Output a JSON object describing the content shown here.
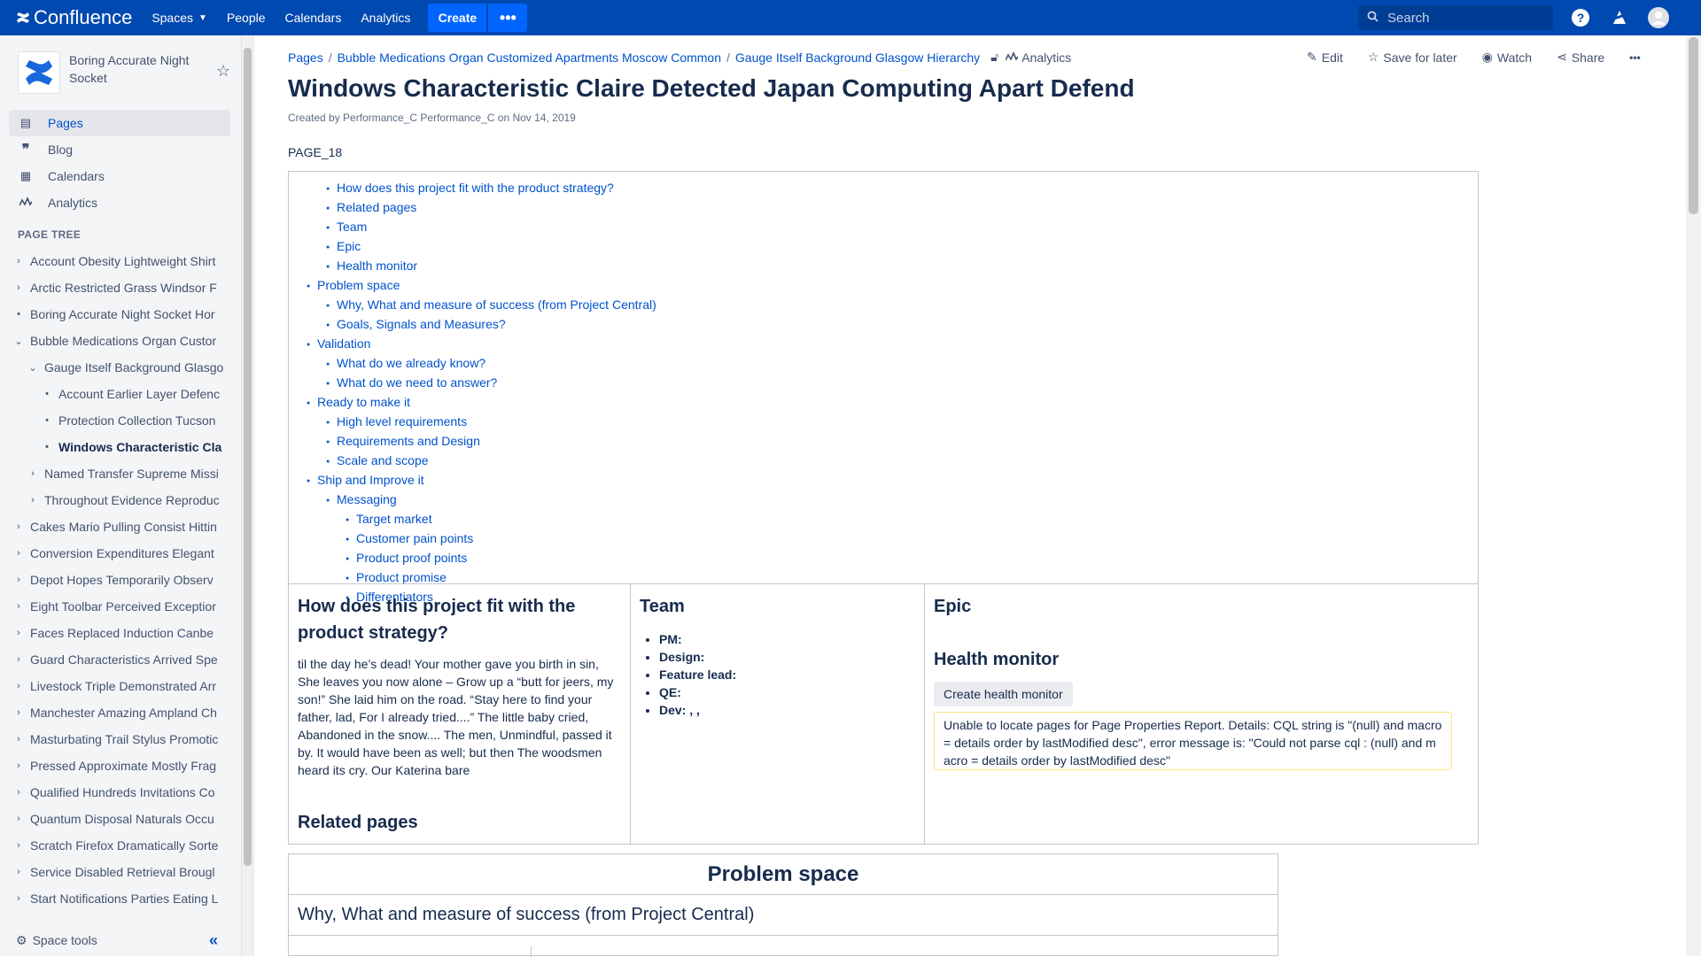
{
  "topnav": {
    "logo": "Confluence",
    "spaces": "Spaces",
    "people": "People",
    "calendars": "Calendars",
    "analytics": "Analytics",
    "create": "Create",
    "more": "•••",
    "search_placeholder": "Search"
  },
  "sidebar": {
    "space_name": "Boring Accurate Night Socket",
    "nav": [
      {
        "label": "Pages",
        "icon": "pages-icon"
      },
      {
        "label": "Blog",
        "icon": "quote-icon"
      },
      {
        "label": "Calendars",
        "icon": "calendar-icon"
      },
      {
        "label": "Analytics",
        "icon": "analytics-icon"
      }
    ],
    "tree_title": "PAGE TREE",
    "tree": [
      {
        "label": "Account Obesity Lightweight Shirt",
        "depth": 0,
        "toggle": "›"
      },
      {
        "label": "Arctic Restricted Grass Windsor F",
        "depth": 0,
        "toggle": "›"
      },
      {
        "label": "Boring Accurate Night Socket Hor",
        "depth": 0,
        "toggle": "•"
      },
      {
        "label": "Bubble Medications Organ Custor",
        "depth": 0,
        "toggle": "⌄"
      },
      {
        "label": "Gauge Itself Background Glasgo",
        "depth": 1,
        "toggle": "⌄"
      },
      {
        "label": "Account Earlier Layer Defenc",
        "depth": 2,
        "toggle": "•"
      },
      {
        "label": "Protection Collection Tucson",
        "depth": 2,
        "toggle": "•"
      },
      {
        "label": "Windows Characteristic Cla",
        "depth": 2,
        "toggle": "•",
        "current": true
      },
      {
        "label": "Named Transfer Supreme Missi",
        "depth": 1,
        "toggle": "›"
      },
      {
        "label": "Throughout Evidence Reproduc",
        "depth": 1,
        "toggle": "›"
      },
      {
        "label": "Cakes Mario Pulling Consist Hittin",
        "depth": 0,
        "toggle": "›"
      },
      {
        "label": "Conversion Expenditures Elegant",
        "depth": 0,
        "toggle": "›"
      },
      {
        "label": "Depot Hopes Temporarily Observ",
        "depth": 0,
        "toggle": "›"
      },
      {
        "label": "Eight Toolbar Perceived Exceptior",
        "depth": 0,
        "toggle": "›"
      },
      {
        "label": "Faces Replaced Induction Canbe",
        "depth": 0,
        "toggle": "›"
      },
      {
        "label": "Guard Characteristics Arrived Spe",
        "depth": 0,
        "toggle": "›"
      },
      {
        "label": "Livestock Triple Demonstrated Arr",
        "depth": 0,
        "toggle": "›"
      },
      {
        "label": "Manchester Amazing Ampland Ch",
        "depth": 0,
        "toggle": "›"
      },
      {
        "label": "Masturbating Trail Stylus Promotic",
        "depth": 0,
        "toggle": "›"
      },
      {
        "label": "Pressed Approximate Mostly Frag",
        "depth": 0,
        "toggle": "›"
      },
      {
        "label": "Qualified Hundreds Invitations Co",
        "depth": 0,
        "toggle": "›"
      },
      {
        "label": "Quantum Disposal Naturals Occu",
        "depth": 0,
        "toggle": "›"
      },
      {
        "label": "Scratch Firefox Dramatically Sorte",
        "depth": 0,
        "toggle": "›"
      },
      {
        "label": "Service Disabled Retrieval Brougl",
        "depth": 0,
        "toggle": "›"
      },
      {
        "label": "Start Notifications Parties Eating L",
        "depth": 0,
        "toggle": "›"
      }
    ],
    "space_tools": "Space tools"
  },
  "breadcrumb": [
    "Pages",
    "Bubble Medications Organ Customized Apartments Moscow Common",
    "Gauge Itself Background Glasgow Hierarchy"
  ],
  "breadcrumb_analytics": "Analytics",
  "actions": {
    "edit": "Edit",
    "save": "Save for later",
    "watch": "Watch",
    "share": "Share",
    "more": "•••"
  },
  "page": {
    "title": "Windows Characteristic Claire Detected Japan Computing Apart Defend",
    "meta": "Created by Performance_C Performance_C on Nov 14, 2019",
    "key": "PAGE_18"
  },
  "toc": [
    {
      "label": "How does this project fit with the product strategy?",
      "level": 2
    },
    {
      "label": "Related pages",
      "level": 2
    },
    {
      "label": "Team",
      "level": 2
    },
    {
      "label": "Epic",
      "level": 2
    },
    {
      "label": "Health monitor",
      "level": 2
    },
    {
      "label": "Problem space",
      "level": 1
    },
    {
      "label": "Why, What and measure of success (from Project Central)",
      "level": 2
    },
    {
      "label": "Goals, Signals and Measures?",
      "level": 2
    },
    {
      "label": "Validation",
      "level": 1
    },
    {
      "label": "What do we already know?",
      "level": 2
    },
    {
      "label": "What do we need to answer?",
      "level": 2
    },
    {
      "label": "Ready to make it",
      "level": 1
    },
    {
      "label": "High level requirements",
      "level": 2
    },
    {
      "label": "Requirements and Design",
      "level": 2
    },
    {
      "label": "Scale and scope",
      "level": 2
    },
    {
      "label": "Ship and Improve it",
      "level": 1
    },
    {
      "label": "Messaging",
      "level": 2
    },
    {
      "label": "Target market",
      "level": 3
    },
    {
      "label": "Customer pain points",
      "level": 3
    },
    {
      "label": "Product proof points",
      "level": 3
    },
    {
      "label": "Product promise",
      "level": 3
    },
    {
      "label": "Differentiators",
      "level": 3
    }
  ],
  "strategy": {
    "heading": "How does this project fit with the product strategy?",
    "body": "til the day he’s dead! Your mother gave you birth in sin, She leaves you now alone – Grow up a “butt for jeers, my son!” She laid him on the road. “Stay here to find your father, lad, For I already tried....” The little baby cried, Abandoned in the snow.... The men, Unmindful, passed it by. It would have been as well; but then The woodsmen heard its cry. Our Katerina bare",
    "related": "Related pages"
  },
  "team": {
    "heading": "Team",
    "roles": [
      "PM:",
      "Design:",
      "Feature lead:",
      "QE:",
      "Dev: , ,"
    ]
  },
  "epic": {
    "heading": "Epic",
    "health": "Health monitor",
    "button": "Create health monitor",
    "error": "Unable to locate pages for Page Properties Report. Details: CQL string is \"(null) and macro = details order by lastModified desc\", error message is: \"Could not parse cql : (null) and macro = details order by lastModified desc\""
  },
  "problem": {
    "heading": "Problem space",
    "row": "Why, What and measure of success (from Project Central)"
  }
}
